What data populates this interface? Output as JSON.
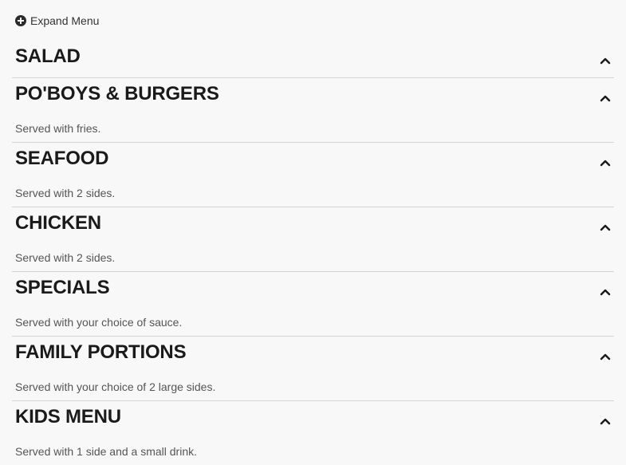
{
  "expand": {
    "label": "Expand Menu",
    "icon": "plus-circle-icon"
  },
  "sections": [
    {
      "title": "SALAD",
      "subtitle": ""
    },
    {
      "title": "PO'BOYS & BURGERS",
      "subtitle": "Served with fries."
    },
    {
      "title": "SEAFOOD",
      "subtitle": "Served with 2 sides."
    },
    {
      "title": "CHICKEN",
      "subtitle": "Served with 2 sides."
    },
    {
      "title": "SPECIALS",
      "subtitle": "Served with your choice of sauce."
    },
    {
      "title": "FAMILY PORTIONS",
      "subtitle": "Served with your choice of 2 large sides."
    },
    {
      "title": "KIDS MENU",
      "subtitle": "Served with 1 side and a small drink."
    }
  ],
  "colors": {
    "background": "#f8f8f8",
    "divider": "#d4d4d4",
    "title": "#1a1a1a",
    "subtitle": "#555555"
  }
}
